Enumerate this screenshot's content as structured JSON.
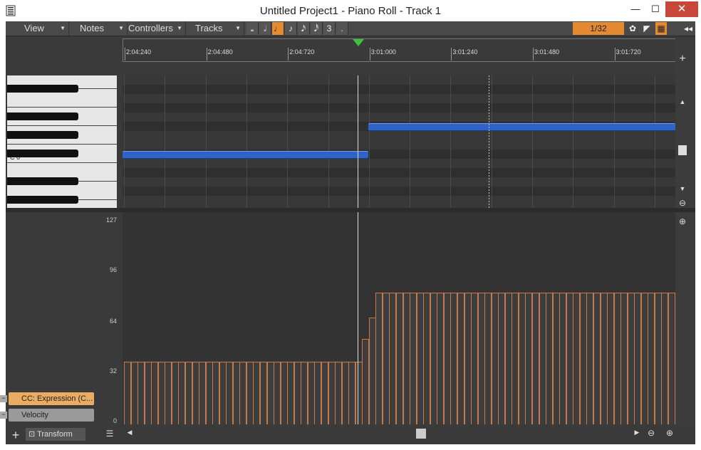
{
  "window": {
    "title": "Untitled Project1 - Piano Roll - Track 1",
    "min": "—",
    "max": "☐",
    "close": "✕"
  },
  "menus": [
    {
      "label": "View"
    },
    {
      "label": "Notes"
    },
    {
      "label": "Controllers"
    },
    {
      "label": "Tracks"
    }
  ],
  "note_buttons": [
    "𝅝",
    "𝅗𝅥",
    "♩",
    "♪",
    "𝅘𝅥𝅯",
    "𝅘𝅥𝅰",
    "3",
    "."
  ],
  "note_active_index": 2,
  "snap": {
    "value": "1/32"
  },
  "timeline": {
    "ticks": [
      "2:04:240",
      "2:04:480",
      "2:04:720",
      "3:01:000",
      "3:01:240",
      "3:01:480",
      "3:01:720"
    ]
  },
  "keyboard": {
    "c6_label": "C 6"
  },
  "notes": [
    {
      "start": "2:04:120",
      "end": "2:04:840",
      "pitch_row": 8
    },
    {
      "start": "2:04:840",
      "end": "3:01:840",
      "pitch_row": 5
    }
  ],
  "controllers": {
    "yticks": [
      "127",
      "96",
      "64",
      "32",
      "0"
    ],
    "lanes": [
      {
        "label": "CC: Expression (C..."
      },
      {
        "label": "Velocity"
      }
    ],
    "values": [
      38,
      38,
      38,
      38,
      38,
      38,
      38,
      38,
      38,
      38,
      38,
      38,
      38,
      38,
      38,
      38,
      38,
      38,
      38,
      38,
      38,
      38,
      38,
      38,
      38,
      38,
      38,
      38,
      38,
      38,
      38,
      38,
      38,
      38,
      38,
      52,
      65,
      80,
      80,
      80,
      80,
      80,
      80,
      80,
      80,
      80,
      80,
      80,
      80,
      80,
      80,
      80,
      80,
      80,
      80,
      80,
      80,
      80,
      80,
      80,
      80,
      80,
      80,
      80,
      80,
      80,
      80,
      80,
      80,
      80,
      80,
      80,
      80,
      80,
      80,
      80,
      80,
      80,
      80,
      80,
      80
    ]
  },
  "bottom": {
    "transform_label": "Transform",
    "add": "+"
  },
  "colors": {
    "accent": "#e38a33",
    "note": "#2f63c8",
    "bar_outline": "#c8794a"
  }
}
